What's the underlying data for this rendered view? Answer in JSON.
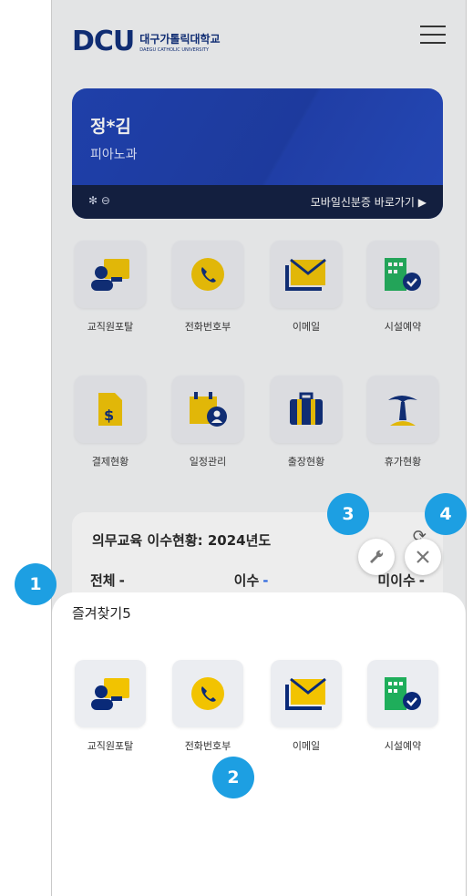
{
  "header": {
    "logo_main": "DCU",
    "logo_kr": "대구가톨릭대학교",
    "logo_en": "DAEGU CATHOLIC UNIVERSITY"
  },
  "id_card": {
    "name": "정*김",
    "department": "피아노과",
    "status_icons": "✻ ⊖",
    "mobile_id_link": "모바일신분증 바로가기 ▶"
  },
  "menu_row1": [
    {
      "label": "교직원포탈",
      "icon": "portal-icon"
    },
    {
      "label": "전화번호부",
      "icon": "phone-icon"
    },
    {
      "label": "이메일",
      "icon": "mail-icon"
    },
    {
      "label": "시설예약",
      "icon": "building-check-icon"
    }
  ],
  "menu_row2": [
    {
      "label": "결제현황",
      "icon": "invoice-icon"
    },
    {
      "label": "일정관리",
      "icon": "calendar-user-icon"
    },
    {
      "label": "출장현황",
      "icon": "suitcase-icon"
    },
    {
      "label": "휴가현황",
      "icon": "palm-tree-icon"
    }
  ],
  "education": {
    "title": "의무교육 이수현황: 2024년도",
    "stats": [
      {
        "label": "전체",
        "value": "-"
      },
      {
        "label": "이수",
        "value": "-"
      },
      {
        "label": "미이수",
        "value": "-"
      }
    ]
  },
  "favorites": {
    "title": "즐겨찾기5",
    "items": [
      {
        "label": "교직원포탈",
        "icon": "portal-icon"
      },
      {
        "label": "전화번호부",
        "icon": "phone-icon"
      },
      {
        "label": "이메일",
        "icon": "mail-icon"
      },
      {
        "label": "시설예약",
        "icon": "building-check-icon"
      }
    ]
  },
  "controls": {
    "edit_icon": "wrench-icon",
    "close_icon": "close-icon"
  },
  "badges": [
    "1",
    "2",
    "3",
    "4"
  ],
  "colors": {
    "navy": "#0a2a78",
    "card_blue": "#1a3fb4",
    "yellow": "#f2c300",
    "green": "#1fae5b",
    "badge": "#1d9fe2"
  }
}
